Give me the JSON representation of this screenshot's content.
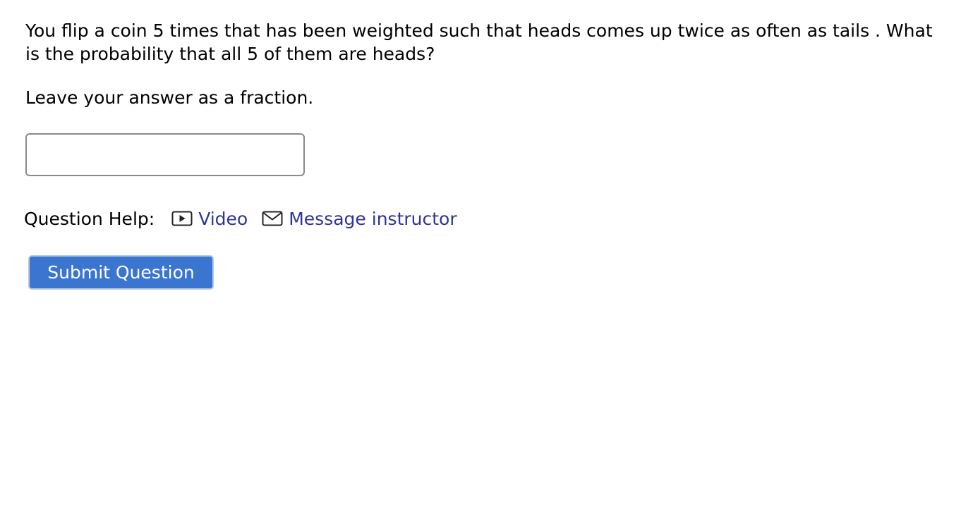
{
  "question": {
    "line1": "You flip a coin 5 times that has been weighted such that heads comes up twice as often as tails . What",
    "line2": "is the probability that all 5 of them are heads?",
    "instruction": "Leave your answer as a fraction."
  },
  "answer_input": {
    "value": "",
    "placeholder": ""
  },
  "help": {
    "label": "Question Help:",
    "video_label": "Video",
    "video_icon": "video-play-icon",
    "message_label": "Message instructor",
    "message_icon": "envelope-icon",
    "link_color": "#2f3596"
  },
  "submit": {
    "label": "Submit Question",
    "color": "#3a75cf"
  }
}
